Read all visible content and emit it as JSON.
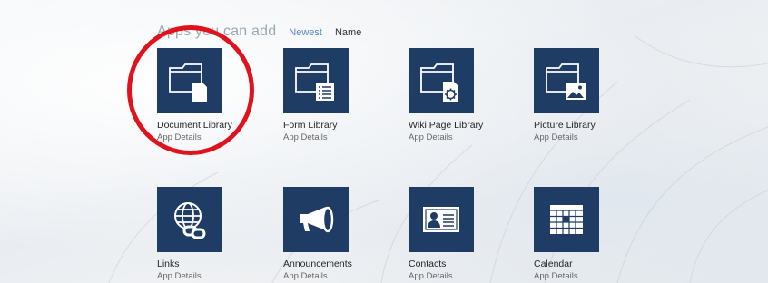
{
  "header": {
    "title": "Apps you can add",
    "sort_newest": "Newest",
    "sort_name": "Name"
  },
  "tiles": [
    {
      "title": "Document Library",
      "sub": "App Details",
      "icon": "document-library-icon"
    },
    {
      "title": "Form Library",
      "sub": "App Details",
      "icon": "form-library-icon"
    },
    {
      "title": "Wiki Page Library",
      "sub": "App Details",
      "icon": "wiki-page-library-icon"
    },
    {
      "title": "Picture Library",
      "sub": "App Details",
      "icon": "picture-library-icon"
    },
    {
      "title": "Links",
      "sub": "App Details",
      "icon": "links-icon"
    },
    {
      "title": "Announcements",
      "sub": "App Details",
      "icon": "announcements-icon"
    },
    {
      "title": "Contacts",
      "sub": "App Details",
      "icon": "contacts-icon"
    },
    {
      "title": "Calendar",
      "sub": "App Details",
      "icon": "calendar-icon"
    }
  ],
  "colors": {
    "tile_bg": "#1f3c64",
    "highlight": "#e0121c",
    "link": "#5a87b8"
  }
}
